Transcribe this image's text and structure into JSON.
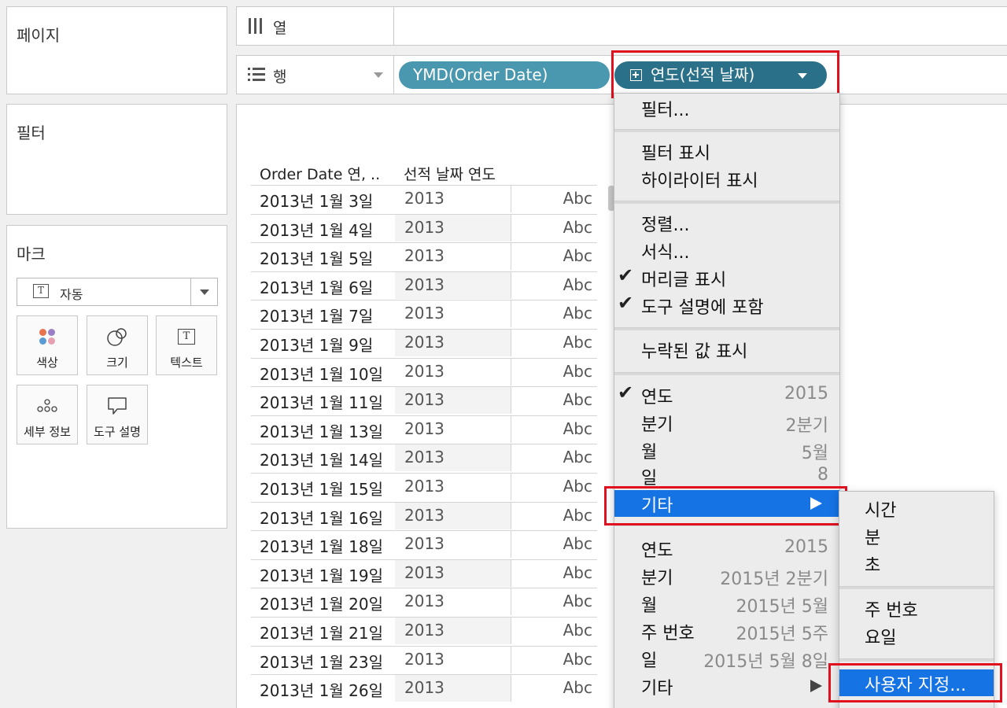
{
  "colors": {
    "accent": "#1673e4",
    "pill_dim": "#4a98b0",
    "pill_date": "#2b7089",
    "highlight_box": "#e0101f"
  },
  "pages_panel": {
    "title": "페이지"
  },
  "filters_panel": {
    "title": "필터"
  },
  "marks_panel": {
    "title": "마크",
    "mark_type": {
      "icon": "text-icon",
      "value": "자동"
    },
    "buttons": [
      {
        "label": "색상",
        "icon": "color-dots-icon"
      },
      {
        "label": "크기",
        "icon": "size-circles-icon"
      },
      {
        "label": "텍스트",
        "icon": "text-icon"
      },
      {
        "label": "세부 정보",
        "icon": "detail-dots-icon"
      },
      {
        "label": "도구 설명",
        "icon": "tooltip-icon"
      }
    ]
  },
  "columns_shelf": {
    "label": "열",
    "icon": "columns-icon"
  },
  "rows_shelf": {
    "label": "행",
    "icon": "rows-icon",
    "pills": [
      {
        "label": "YMD(Order Date)"
      },
      {
        "label": "연도(선적 날짜)"
      }
    ]
  },
  "view": {
    "headers": [
      "Order Date 연, ..",
      "선적 날짜 연도"
    ],
    "rows": [
      [
        "2013년 1월 3일",
        "2013",
        "Abc"
      ],
      [
        "2013년 1월 4일",
        "2013",
        "Abc"
      ],
      [
        "2013년 1월 5일",
        "2013",
        "Abc"
      ],
      [
        "2013년 1월 6일",
        "2013",
        "Abc"
      ],
      [
        "2013년 1월 7일",
        "2013",
        "Abc"
      ],
      [
        "2013년 1월 9일",
        "2013",
        "Abc"
      ],
      [
        "2013년 1월 10일",
        "2013",
        "Abc"
      ],
      [
        "2013년 1월 11일",
        "2013",
        "Abc"
      ],
      [
        "2013년 1월 13일",
        "2013",
        "Abc"
      ],
      [
        "2013년 1월 14일",
        "2013",
        "Abc"
      ],
      [
        "2013년 1월 15일",
        "2013",
        "Abc"
      ],
      [
        "2013년 1월 16일",
        "2013",
        "Abc"
      ],
      [
        "2013년 1월 18일",
        "2013",
        "Abc"
      ],
      [
        "2013년 1월 19일",
        "2013",
        "Abc"
      ],
      [
        "2013년 1월 20일",
        "2013",
        "Abc"
      ],
      [
        "2013년 1월 21일",
        "2013",
        "Abc"
      ],
      [
        "2013년 1월 23일",
        "2013",
        "Abc"
      ],
      [
        "2013년 1월 26일",
        "2013",
        "Abc"
      ]
    ]
  },
  "context_menu": {
    "items": [
      {
        "label": "필터..."
      },
      {
        "label": "필터 표시"
      },
      {
        "label": "하이라이터 표시"
      },
      {
        "label": "정렬..."
      },
      {
        "label": "서식..."
      },
      {
        "label": "머리글 표시",
        "checked": true
      },
      {
        "label": "도구 설명에 포함",
        "checked": true
      },
      {
        "label": "누락된 값 표시"
      },
      {
        "label": "연도",
        "value": "2015",
        "checked": true
      },
      {
        "label": "분기",
        "value": "2분기"
      },
      {
        "label": "월",
        "value": "5월"
      },
      {
        "label": "일",
        "value": "8"
      },
      {
        "label": "기타",
        "submenu": true,
        "highlighted": true
      },
      {
        "label": "연도",
        "value": "2015"
      },
      {
        "label": "분기",
        "value": "2015년 2분기"
      },
      {
        "label": "월",
        "value": "2015년 5월"
      },
      {
        "label": "주 번호",
        "value": "2015년 5주"
      },
      {
        "label": "일",
        "value": "2015년 5월 8일"
      },
      {
        "label": "기타",
        "submenu": true
      }
    ]
  },
  "submenu": {
    "items": [
      {
        "label": "시간"
      },
      {
        "label": "분"
      },
      {
        "label": "초"
      },
      {
        "label": "주 번호"
      },
      {
        "label": "요일"
      },
      {
        "label": "사용자 지정...",
        "highlighted": true
      }
    ]
  }
}
